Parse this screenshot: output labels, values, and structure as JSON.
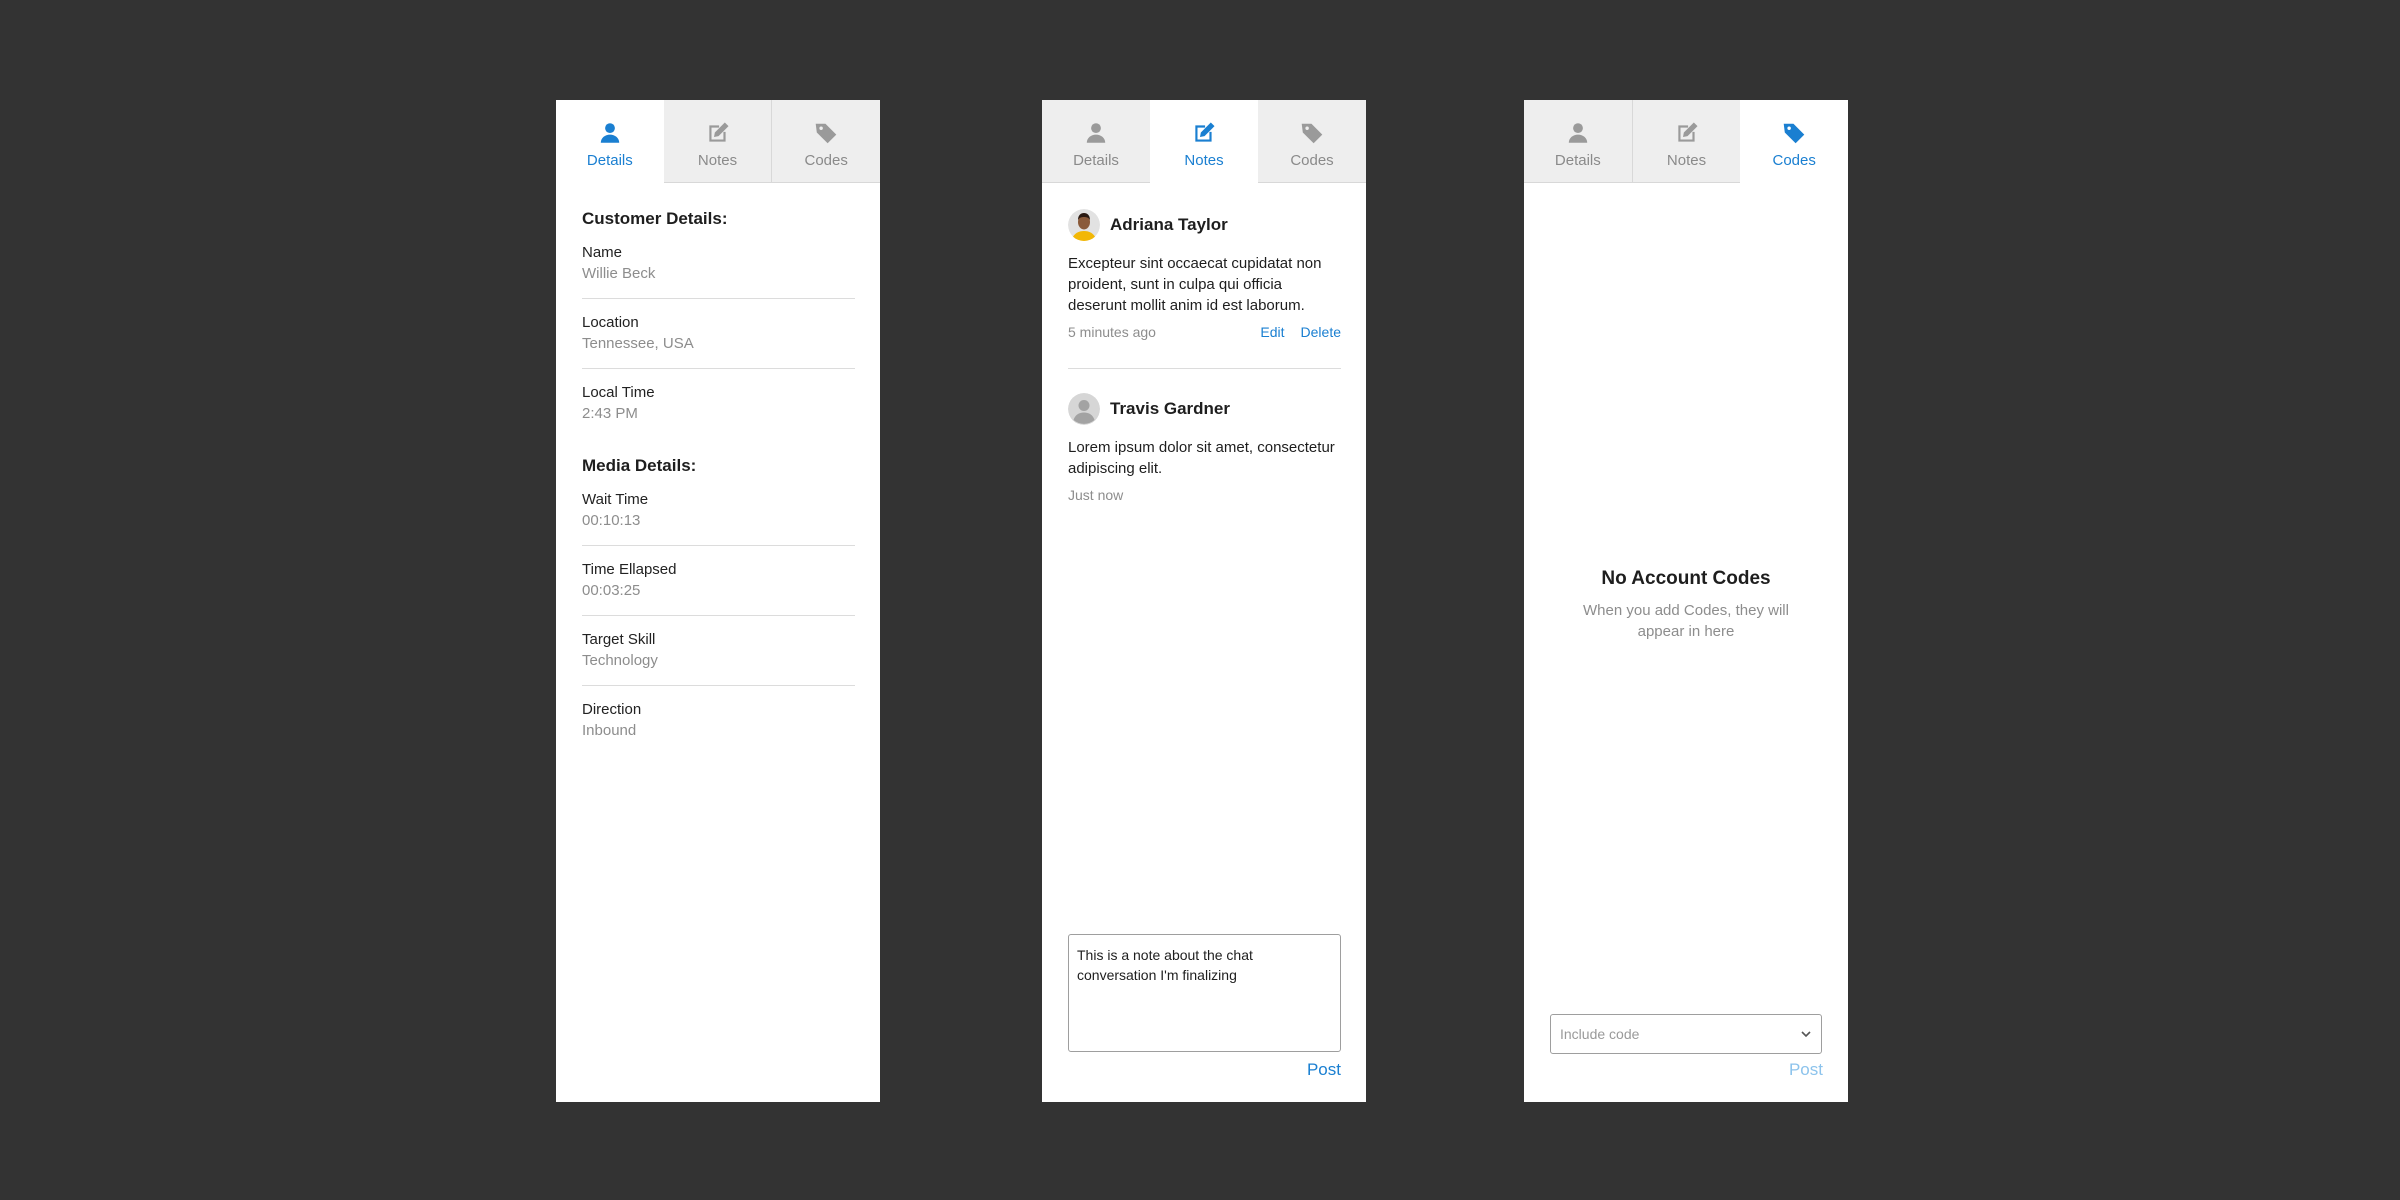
{
  "tabs": [
    {
      "label": "Details",
      "icon": "person-icon"
    },
    {
      "label": "Notes",
      "icon": "edit-note-icon"
    },
    {
      "label": "Codes",
      "icon": "tag-icon"
    }
  ],
  "details": {
    "customer_title": "Customer Details:",
    "customer_fields": [
      {
        "label": "Name",
        "value": "Willie Beck"
      },
      {
        "label": "Location",
        "value": "Tennessee, USA"
      },
      {
        "label": "Local Time",
        "value": "2:43 PM"
      }
    ],
    "media_title": "Media Details:",
    "media_fields": [
      {
        "label": "Wait Time",
        "value": "00:10:13"
      },
      {
        "label": "Time Ellapsed",
        "value": "00:03:25"
      },
      {
        "label": "Target Skill",
        "value": "Technology"
      },
      {
        "label": "Direction",
        "value": "Inbound"
      }
    ]
  },
  "notes": {
    "items": [
      {
        "author": "Adriana Taylor",
        "text": "Excepteur sint occaecat cupidatat non proident, sunt in culpa qui officia deserunt mollit anim id est laborum.",
        "time": "5 minutes ago",
        "edit_label": "Edit",
        "delete_label": "Delete"
      },
      {
        "author": "Travis Gardner",
        "text": "Lorem ipsum dolor sit amet, consectetur adipiscing elit.",
        "time": "Just now"
      }
    ],
    "draft": "This is a note about the chat conversation I'm finalizing",
    "post_label": "Post"
  },
  "codes": {
    "empty_title": "No Account Codes",
    "empty_subtitle": "When you add Codes, they will appear in here",
    "select_placeholder": "Include code",
    "post_label": "Post"
  },
  "colors": {
    "accent": "#1a7fd1",
    "background": "#333333",
    "muted": "#8d8d8d"
  }
}
